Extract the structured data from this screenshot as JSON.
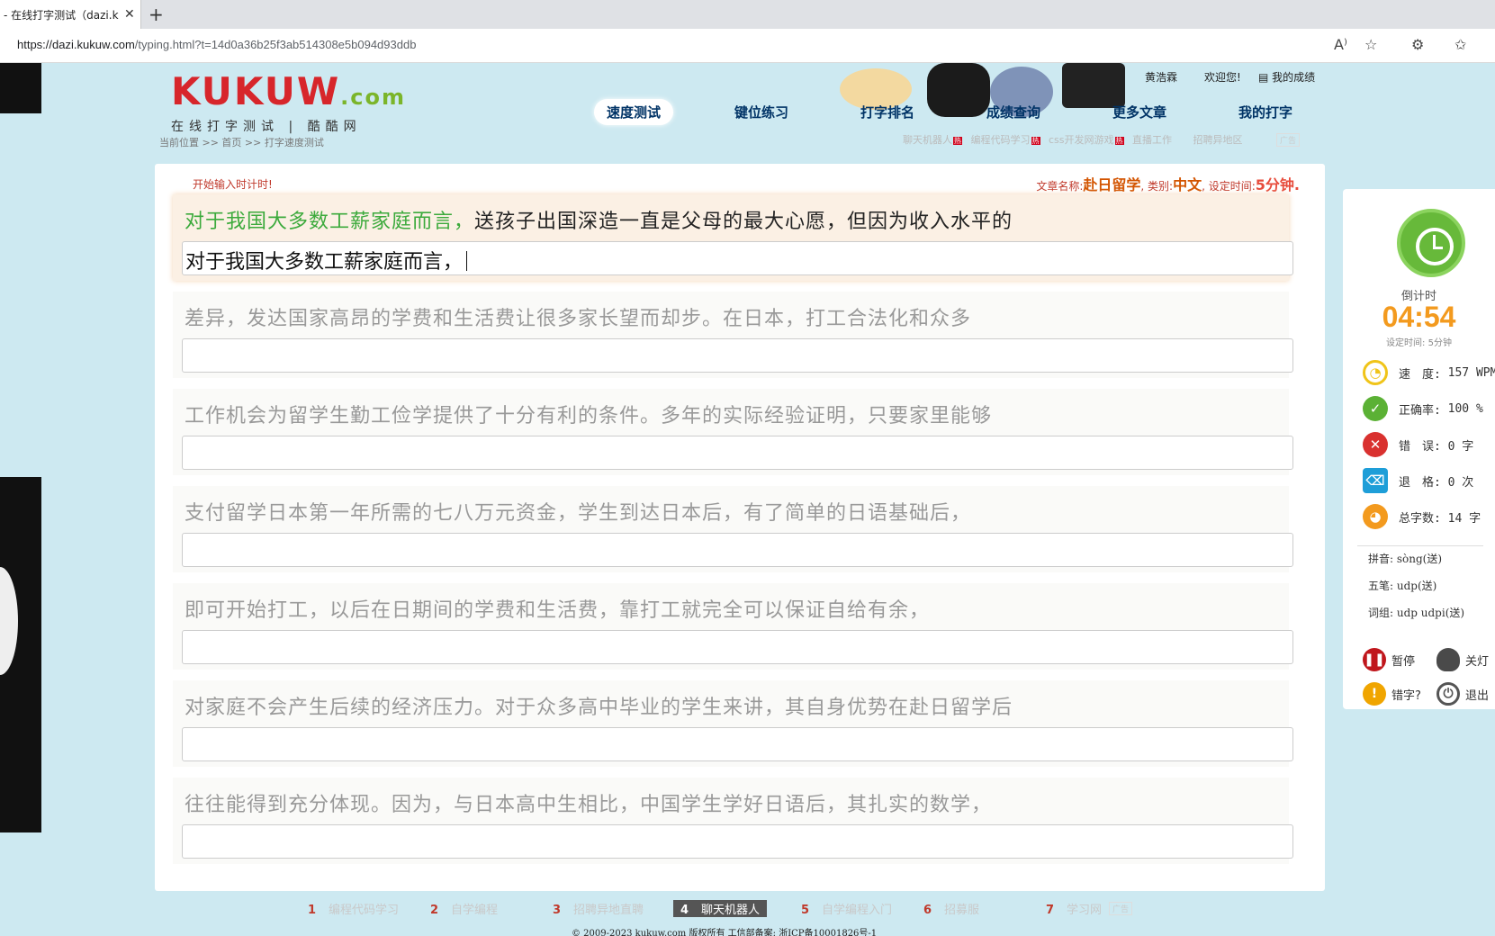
{
  "browser": {
    "tab_title": "- 在线打字测试（dazi.k",
    "url_host": "https://dazi.kukuw.com",
    "url_path": "/typing.html?t=14d0a36b25f3ab514308e5b094d93ddb"
  },
  "logo": {
    "main": "KUKUW",
    "suffix": ".com",
    "subtitle": "在线打字测试 | 酷酷网"
  },
  "nav": [
    "速度测试",
    "键位练习",
    "打字排名",
    "成绩查询",
    "更多文章",
    "我的打字"
  ],
  "top_links": {
    "user": "黄浩霖",
    "welcome": "欢迎您!",
    "my_scores": "我的成绩"
  },
  "breadcrumb": "当前位置 >> 首页 >> 打字速度测试",
  "hot_links": [
    "聊天机器人",
    "编程代码学习",
    "css开发网游戏",
    "直播工作",
    "招聘异地区"
  ],
  "ad_label": "广告",
  "main": {
    "hint": "开始输入时计时!",
    "article_label": "文章名称:",
    "article_name": "赴日留学",
    "category_label": "类别:",
    "category": "中文",
    "time_label": "设定时间:",
    "time_value": "5分钟."
  },
  "lines": [
    {
      "done": "对于我国大多数工薪家庭而言，",
      "todo": "送孩子出国深造一直是父母的最大心愿，但因为收入水平的",
      "typed": "对于我国大多数工薪家庭而言，"
    },
    {
      "done": "",
      "todo": "差异，发达国家高昂的学费和生活费让很多家长望而却步。在日本，打工合法化和众多",
      "typed": ""
    },
    {
      "done": "",
      "todo": "工作机会为留学生勤工俭学提供了十分有利的条件。多年的实际经验证明，只要家里能够",
      "typed": ""
    },
    {
      "done": "",
      "todo": "支付留学日本第一年所需的七八万元资金，学生到达日本后，有了简单的日语基础后，",
      "typed": ""
    },
    {
      "done": "",
      "todo": "即可开始打工，以后在日期间的学费和生活费，靠打工就完全可以保证自给有余，",
      "typed": ""
    },
    {
      "done": "",
      "todo": "对家庭不会产生后续的经济压力。对于众多高中毕业的学生来讲，其自身优势在赴日留学后",
      "typed": ""
    },
    {
      "done": "",
      "todo": "往往能得到充分体现。因为，与日本高中生相比，中国学生学好日语后，其扎实的数学，",
      "typed": ""
    }
  ],
  "side": {
    "countdown_label": "倒计时",
    "countdown": "04:54",
    "set_time": "设定时间: 5分钟",
    "stats": [
      {
        "icon": "speed-icon",
        "label": "速　度:",
        "value": "157 WPM",
        "color": "#f0c419"
      },
      {
        "icon": "check-icon",
        "label": "正确率:",
        "value": "100 %",
        "color": "#5bb135"
      },
      {
        "icon": "error-icon",
        "label": "错　误:",
        "value": "0 字",
        "color": "#d9312f"
      },
      {
        "icon": "backspace-icon",
        "label": "退　格:",
        "value": "0 次",
        "color": "#1e9ed8"
      },
      {
        "icon": "pie-icon",
        "label": "总字数:",
        "value": "14 字",
        "color": "#f39a1e"
      }
    ],
    "pinyin": "拼音: sòng(送)",
    "wubi": "五笔: udp(送)",
    "cizu": "词组: udp udpi(送)",
    "pause": "暂停",
    "light": "关灯",
    "typo": "错字?",
    "exit": "退出"
  },
  "footer": {
    "links": [
      {
        "n": "1",
        "label": "编程代码学习"
      },
      {
        "n": "2",
        "label": "自学编程"
      },
      {
        "n": "3",
        "label": "招聘异地直聘"
      },
      {
        "n": "4",
        "label": "聊天机器人"
      },
      {
        "n": "5",
        "label": "自学编程入门"
      },
      {
        "n": "6",
        "label": "招募服"
      },
      {
        "n": "7",
        "label": "学习网"
      }
    ],
    "copyright": "© 2009-2023 kukuw.com 版权所有 工信部备案: 浙ICP备10001826号-1"
  }
}
